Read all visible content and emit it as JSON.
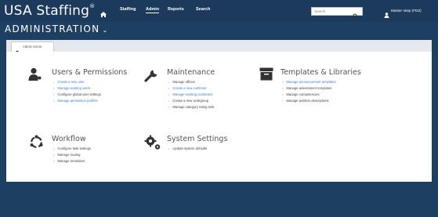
{
  "header": {
    "brand": "USA Staffing",
    "brand_mark": "®",
    "nav": [
      "Staffing",
      "Admin",
      "Reports",
      "Search"
    ],
    "search_placeholder": "Search",
    "user": "Master Vasp (FDZ)"
  },
  "page_title": "ADMINISTRATION",
  "page_title_caret": "⌄",
  "tab_label": "Admin Home",
  "colors": {
    "header_bg": "#1b3a5c",
    "page_bg": "#1d3f62",
    "link": "#3d7fc1",
    "icon": "#333333"
  },
  "sections": [
    {
      "title": "Users & Permissions",
      "icon": "user-icon",
      "items": [
        {
          "label": "Create a new user",
          "link": true
        },
        {
          "label": "Manage existing users",
          "link": true
        },
        {
          "label": "Configure global user settings",
          "link": false
        },
        {
          "label": "Manage permission profiles",
          "link": true
        }
      ]
    },
    {
      "title": "Maintenance",
      "icon": "wrench-icon",
      "items": [
        {
          "label": "Manage offices",
          "link": false
        },
        {
          "label": "Create a new customer",
          "link": true
        },
        {
          "label": "Manage existing customers",
          "link": true
        },
        {
          "label": "Create a new workgroup",
          "link": false
        },
        {
          "label": "Manage category rating sets",
          "link": false
        }
      ]
    },
    {
      "title": "Templates & Libraries",
      "icon": "archive-icon",
      "items": [
        {
          "label": "Manage announcement templates",
          "link": true
        },
        {
          "label": "Manage assessment templates",
          "link": false
        },
        {
          "label": "Manage competencies",
          "link": false
        },
        {
          "label": "Manage position descriptions",
          "link": false
        }
      ]
    },
    {
      "title": "Workflow",
      "icon": "workflow-icon",
      "items": [
        {
          "label": "Configure task settings",
          "link": false
        },
        {
          "label": "Manage routing",
          "link": false
        },
        {
          "label": "Manage reminders",
          "link": false
        }
      ]
    },
    {
      "title": "System Settings",
      "icon": "gears-icon",
      "items": [
        {
          "label": "Update system defaults",
          "link": false
        }
      ]
    }
  ]
}
